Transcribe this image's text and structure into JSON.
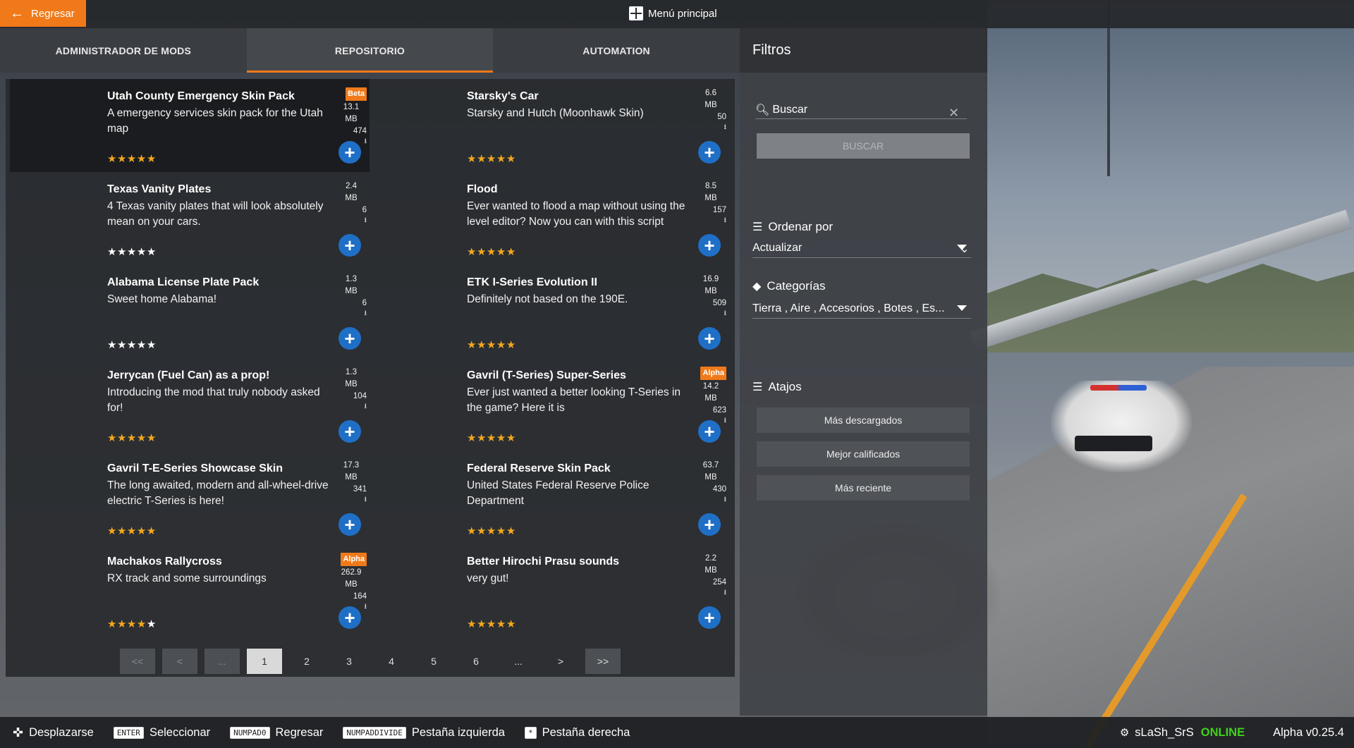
{
  "topbar": {
    "back_label": "Regresar",
    "main_menu_label": "Menú principal"
  },
  "tabs": [
    {
      "label": "ADMINISTRADOR DE MODS",
      "active": false
    },
    {
      "label": "REPOSITORIO",
      "active": true
    },
    {
      "label": "AUTOMATION",
      "active": false
    }
  ],
  "mods": [
    {
      "title": "Utah County Emergency Skin Pack",
      "desc": "A emergency services skin pack for the Utah map",
      "stars": 5,
      "badge": "Beta",
      "size": "13.1",
      "unit": "MB",
      "downloads": "474",
      "selected": true
    },
    {
      "title": "Starsky's Car",
      "desc": "Starsky and Hutch (Moonhawk Skin)",
      "stars": 5,
      "badge": "",
      "size": "6.6",
      "unit": "MB",
      "downloads": "50",
      "selected": false
    },
    {
      "title": "Texas Vanity Plates",
      "desc": "4 Texas vanity plates that will look absolutely mean on your cars.",
      "stars": 0,
      "badge": "",
      "size": "2.4",
      "unit": "MB",
      "downloads": "6",
      "selected": false
    },
    {
      "title": "Flood",
      "desc": "Ever wanted to flood a map without using the level editor? Now you can with this script",
      "stars": 5,
      "badge": "",
      "size": "8.5",
      "unit": "MB",
      "downloads": "157",
      "selected": false
    },
    {
      "title": "Alabama License Plate Pack",
      "desc": "Sweet home Alabama!",
      "stars": 0,
      "badge": "",
      "size": "1.3",
      "unit": "MB",
      "downloads": "6",
      "selected": false
    },
    {
      "title": "ETK I-Series Evolution II",
      "desc": "Definitely not based on the 190E.",
      "stars": 5,
      "badge": "",
      "size": "16.9",
      "unit": "MB",
      "downloads": "509",
      "selected": false
    },
    {
      "title": "Jerrycan (Fuel Can) as a prop!",
      "desc": "Introducing the mod that truly nobody asked for!",
      "stars": 5,
      "badge": "",
      "size": "1.3",
      "unit": "MB",
      "downloads": "104",
      "selected": false
    },
    {
      "title": "Gavril (T-Series) Super-Series",
      "desc": "Ever just wanted a better looking T-Series in the game? Here it is",
      "stars": 5,
      "badge": "Alpha",
      "size": "14.2",
      "unit": "MB",
      "downloads": "623",
      "selected": false
    },
    {
      "title": "Gavril T-E-Series Showcase Skin",
      "desc": "The long awaited, modern and all-wheel-drive electric T-Series is here!",
      "stars": 5,
      "badge": "",
      "size": "17.3",
      "unit": "MB",
      "downloads": "341",
      "selected": false
    },
    {
      "title": "Federal Reserve Skin Pack",
      "desc": "United States Federal Reserve Police Department",
      "stars": 5,
      "badge": "",
      "size": "63.7",
      "unit": "MB",
      "downloads": "430",
      "selected": false
    },
    {
      "title": "Machakos Rallycross",
      "desc": "RX track and some surroundings",
      "stars": 4,
      "badge": "Alpha",
      "size": "262.9",
      "unit": "MB",
      "downloads": "164",
      "selected": false
    },
    {
      "title": "Better Hirochi Prasu sounds",
      "desc": "very gut!",
      "stars": 5,
      "badge": "",
      "size": "2.2",
      "unit": "MB",
      "downloads": "254",
      "selected": false
    }
  ],
  "pagination": [
    {
      "label": "<<",
      "style": "disabled"
    },
    {
      "label": "<",
      "style": "disabled"
    },
    {
      "label": "...",
      "style": "disabled"
    },
    {
      "label": "1",
      "style": "current"
    },
    {
      "label": "2",
      "style": "plain"
    },
    {
      "label": "3",
      "style": "plain"
    },
    {
      "label": "4",
      "style": "plain"
    },
    {
      "label": "5",
      "style": "plain"
    },
    {
      "label": "6",
      "style": "plain"
    },
    {
      "label": "...",
      "style": "plain"
    },
    {
      "label": ">",
      "style": "plain"
    },
    {
      "label": ">>",
      "style": "box"
    }
  ],
  "filters": {
    "title": "Filtros",
    "search_placeholder": "Buscar",
    "search_button": "BUSCAR",
    "sort_label": "Ordenar por",
    "sort_value": "Actualizar",
    "categories_label": "Categorías",
    "categories_value": "Tierra , Aire , Accesorios , Botes , Es...",
    "shortcuts_label": "Atajos",
    "shortcuts": [
      "Más descargados",
      "Mejor calificados",
      "Más reciente"
    ]
  },
  "bottombar": {
    "hints": [
      {
        "key": "",
        "label": "Desplazarse"
      },
      {
        "key": "ENTER",
        "label": "Seleccionar"
      },
      {
        "key": "NUMPAD0",
        "label": "Regresar"
      },
      {
        "key": "NUMPADDIVIDE",
        "label": "Pestaña izquierda"
      },
      {
        "key": "*",
        "label": "Pestaña derecha"
      }
    ],
    "username": "sLaSh_SrS",
    "status": "ONLINE",
    "version": "Alpha v0.25.4"
  },
  "colors": {
    "accent": "#f07a1a",
    "add_button": "#1f6fc6",
    "star": "#f3a81d",
    "online": "#43d11b"
  }
}
